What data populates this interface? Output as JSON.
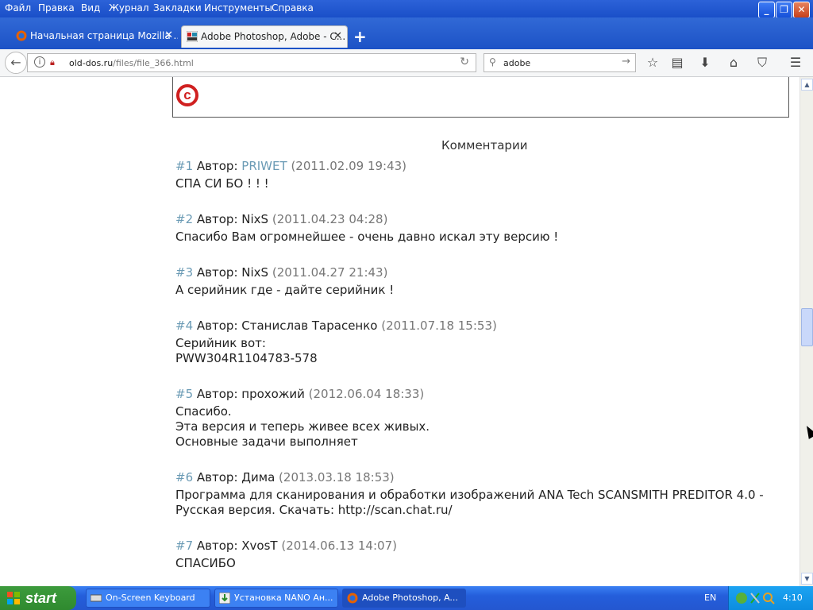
{
  "menu": [
    "Файл",
    "Правка",
    "Вид",
    "Журнал",
    "Закладки",
    "Инструменты",
    "Справка"
  ],
  "window_buttons": {
    "minimize": "_",
    "maximize": "❐",
    "close": "✕"
  },
  "tabs": [
    {
      "title": "Начальная страница Mozilla ...",
      "close": "✕"
    },
    {
      "title": "Adobe Photoshop, Adobe - C...",
      "close": "✕"
    }
  ],
  "new_tab": "+",
  "navbar": {
    "url_domain": "old-dos.ru",
    "url_path": "/files/file_366.html",
    "search_value": "adobe"
  },
  "content": {
    "comments_title": "Комментарии",
    "comments": [
      {
        "num": "#1",
        "author_label": "Автор:",
        "author": "PRIWET",
        "author_link": true,
        "date": "(2011.02.09 19:43)",
        "text": "СПА СИ БО ! ! !"
      },
      {
        "num": "#2",
        "author_label": "Автор:",
        "author": "NixS",
        "author_link": false,
        "date": "(2011.04.23 04:28)",
        "text": "Спасибо Вам огромнейшее - очень давно искал эту версию !"
      },
      {
        "num": "#3",
        "author_label": "Автор:",
        "author": "NixS",
        "author_link": false,
        "date": "(2011.04.27 21:43)",
        "text": "А серийник где - дайте серийник !"
      },
      {
        "num": "#4",
        "author_label": "Автор:",
        "author": "Станислав Тарасенко",
        "author_link": false,
        "date": "(2011.07.18 15:53)",
        "text": "Серийник вот:\nPWW304R1104783-578"
      },
      {
        "num": "#5",
        "author_label": "Автор:",
        "author": "прохожий",
        "author_link": false,
        "date": "(2012.06.04 18:33)",
        "text": "Спасибо.\nЭта версия и теперь живее всех живых.\nОсновные задачи выполняет"
      },
      {
        "num": "#6",
        "author_label": "Автор:",
        "author": "Дима",
        "author_link": false,
        "date": "(2013.03.18 18:53)",
        "text": "Программа для сканирования и обработки изображений ANA Tech SCANSMITH PREDITOR 4.0 -\nРусская версия. Скачать: http://scan.chat.ru/"
      },
      {
        "num": "#7",
        "author_label": "Автор:",
        "author": "XvosT",
        "author_link": false,
        "date": "(2014.06.13 14:07)",
        "text": "СПАСИБО"
      }
    ]
  },
  "taskbar": {
    "start": "start",
    "tasks": [
      "On-Screen Keyboard",
      "Установка NANO Ан...",
      "Adobe Photoshop, A..."
    ],
    "lang": "EN",
    "clock": "4:10"
  },
  "colors": {
    "link": "#6b9bb5",
    "date": "#777777",
    "copyright": "#d02020"
  }
}
